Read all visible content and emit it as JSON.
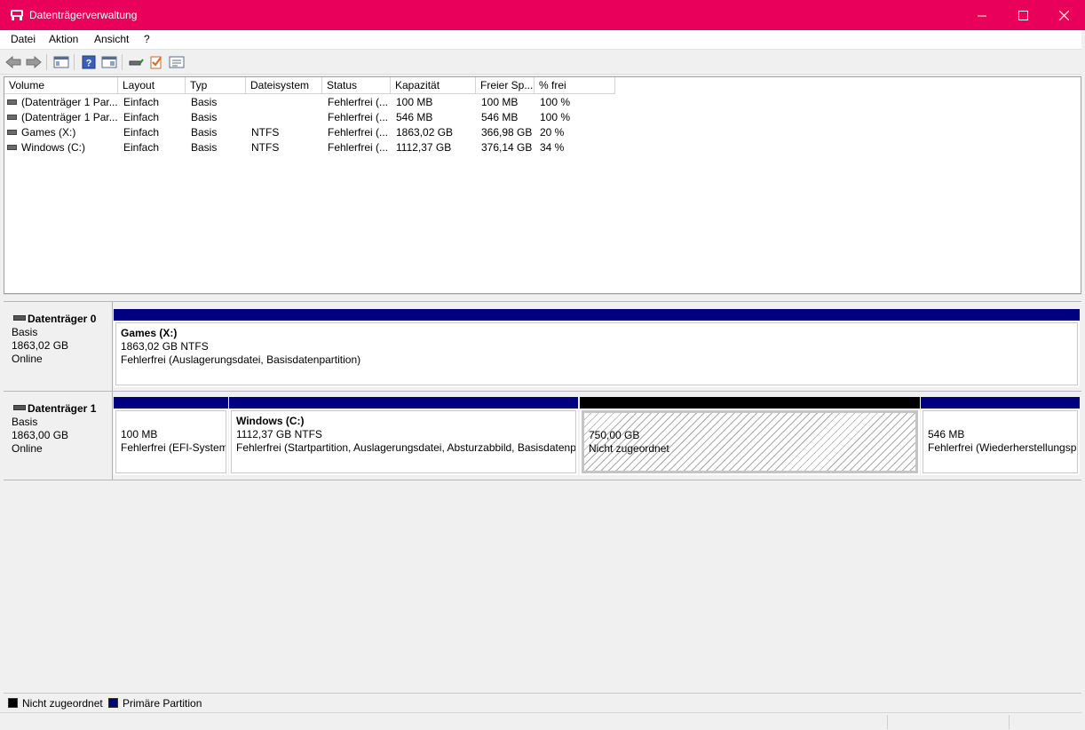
{
  "window": {
    "title": "Datenträgerverwaltung"
  },
  "menu": [
    "Datei",
    "Aktion",
    "Ansicht",
    "?"
  ],
  "volume_list": {
    "columns": [
      "Volume",
      "Layout",
      "Typ",
      "Dateisystem",
      "Status",
      "Kapazität",
      "Freier Sp...",
      "% frei"
    ],
    "rows": [
      [
        "(Datenträger 1 Par...",
        "Einfach",
        "Basis",
        "",
        "Fehlerfrei (...",
        "100 MB",
        "100 MB",
        "100 %"
      ],
      [
        "(Datenträger 1 Par...",
        "Einfach",
        "Basis",
        "",
        "Fehlerfrei (...",
        "546 MB",
        "546 MB",
        "100 %"
      ],
      [
        "Games (X:)",
        "Einfach",
        "Basis",
        "NTFS",
        "Fehlerfrei (...",
        "1863,02 GB",
        "366,98 GB",
        "20 %"
      ],
      [
        "Windows (C:)",
        "Einfach",
        "Basis",
        "NTFS",
        "Fehlerfrei (...",
        "1112,37 GB",
        "376,14 GB",
        "34 %"
      ]
    ]
  },
  "disks": [
    {
      "name": "Datenträger 0",
      "type": "Basis",
      "size": "1863,02 GB",
      "state": "Online",
      "partitions": [
        {
          "title": "Games  (X:)",
          "size": "1863,02 GB NTFS",
          "status": "Fehlerfrei (Auslagerungsdatei, Basisdatenpartition)",
          "kind": "primary"
        }
      ]
    },
    {
      "name": "Datenträger 1",
      "type": "Basis",
      "size": "1863,00 GB",
      "state": "Online",
      "partitions": [
        {
          "title": "",
          "size": "100 MB",
          "status": "Fehlerfrei (EFI-Systempartition)",
          "kind": "primary"
        },
        {
          "title": "Windows  (C:)",
          "size": "1112,37 GB NTFS",
          "status": "Fehlerfrei (Startpartition, Auslagerungsdatei, Absturzabbild, Basisdatenpartition)",
          "kind": "primary"
        },
        {
          "title": "",
          "size": "750,00 GB",
          "status": "Nicht zugeordnet",
          "kind": "unallocated"
        },
        {
          "title": "",
          "size": "546 MB",
          "status": "Fehlerfrei (Wiederherstellungspartition)",
          "kind": "primary"
        }
      ]
    }
  ],
  "legend": [
    {
      "label": "Nicht zugeordnet",
      "color": "#000000"
    },
    {
      "label": "Primäre Partition",
      "color": "#000080"
    }
  ],
  "colors": {
    "titlebar": "#e8005a",
    "primary_partition": "#000080",
    "unallocated": "#000000"
  }
}
